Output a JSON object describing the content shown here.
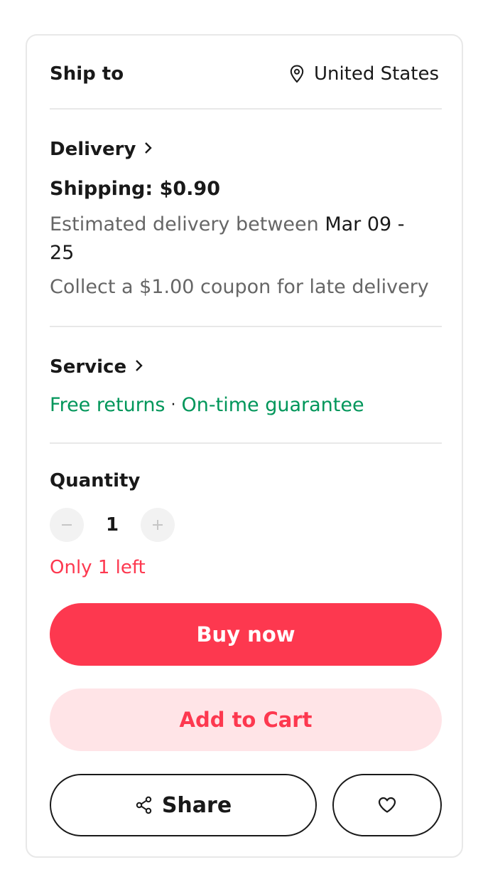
{
  "ship_to": {
    "label": "Ship to",
    "location": "United States",
    "icon": "location-pin-icon"
  },
  "delivery": {
    "title": "Delivery",
    "shipping": "Shipping: $0.90",
    "estimate_prefix": "Estimated delivery between",
    "estimate_date_line1": "Mar 09 -",
    "estimate_date_line2": "25",
    "coupon": "Collect a $1.00 coupon for late delivery"
  },
  "service": {
    "title": "Service",
    "items": [
      "Free returns",
      "On-time guarantee"
    ],
    "separator": "·"
  },
  "quantity": {
    "title": "Quantity",
    "value": "1",
    "stock_note": "Only 1 left"
  },
  "actions": {
    "buy_now": "Buy now",
    "add_to_cart": "Add to Cart",
    "share": "Share",
    "wishlist_icon": "heart-icon"
  },
  "colors": {
    "primary": "#fd384f",
    "primary_soft": "#ffe4e7",
    "success": "#00965a",
    "text": "#191919",
    "muted": "#666666"
  }
}
